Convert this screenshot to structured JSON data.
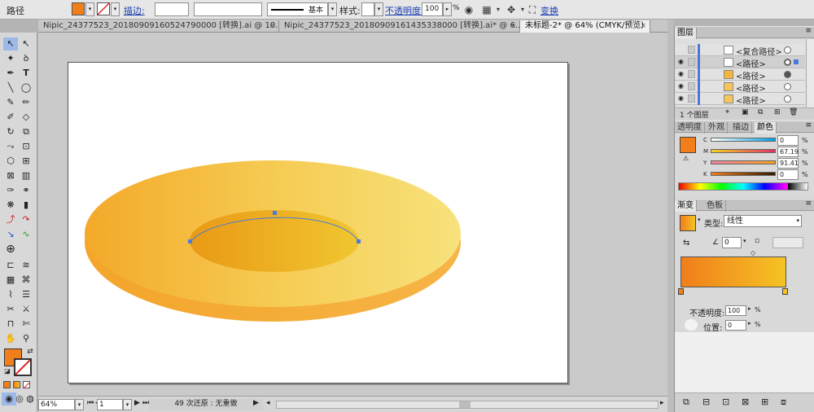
{
  "control_bar": {
    "selection_label": "路径",
    "fill_color": "#f07e1b",
    "stroke_label": "描边:",
    "stroke_profile": "基本",
    "style_label": "样式:",
    "opacity_label": "不透明度:",
    "opacity_value": "100",
    "opacity_unit": "%",
    "transform_link": "变换"
  },
  "tabs": [
    {
      "label": "Nipic_24377523_20180909160524790000   [转换].ai @ 10..."
    },
    {
      "label": "Nipic_24377523_20180909161435338000   [转换].ai* @ 6..."
    },
    {
      "label": "未标题-2* @ 64% (CMYK/预览)"
    }
  ],
  "tools": {
    "fill_color": "#f07e1b"
  },
  "status_bar": {
    "zoom": "64%",
    "artboard": "1",
    "history": "49 次还原 : 无重做"
  },
  "layers_panel": {
    "title": "图层",
    "rows": [
      {
        "name": "<复合路径>"
      },
      {
        "name": "<路径>"
      },
      {
        "name": "<路径>"
      },
      {
        "name": "<路径>"
      },
      {
        "name": "<路径>"
      }
    ],
    "footer": "1 个图层"
  },
  "color_panel": {
    "tabs": [
      "透明度",
      "外观",
      "描边",
      "颜色"
    ],
    "active_tab": "颜色",
    "swatch": "#f07e1b",
    "channels": [
      {
        "label": "C",
        "value": "0",
        "unit": "%"
      },
      {
        "label": "M",
        "value": "67.19",
        "unit": "%"
      },
      {
        "label": "Y",
        "value": "91.41",
        "unit": "%"
      },
      {
        "label": "K",
        "value": "0",
        "unit": "%"
      }
    ]
  },
  "gradient_panel": {
    "tabs": [
      "渐变",
      "色板"
    ],
    "active_tab": "渐变",
    "type_label": "类型:",
    "type_value": "线性",
    "angle_value": "0",
    "opacity_label": "不透明度:",
    "opacity_value": "100",
    "opacity_unit": "%",
    "position_label": "位置:",
    "position_value": "0",
    "position_unit": "%",
    "stop_start": "#f07e1b",
    "stop_end": "#f5c324"
  }
}
